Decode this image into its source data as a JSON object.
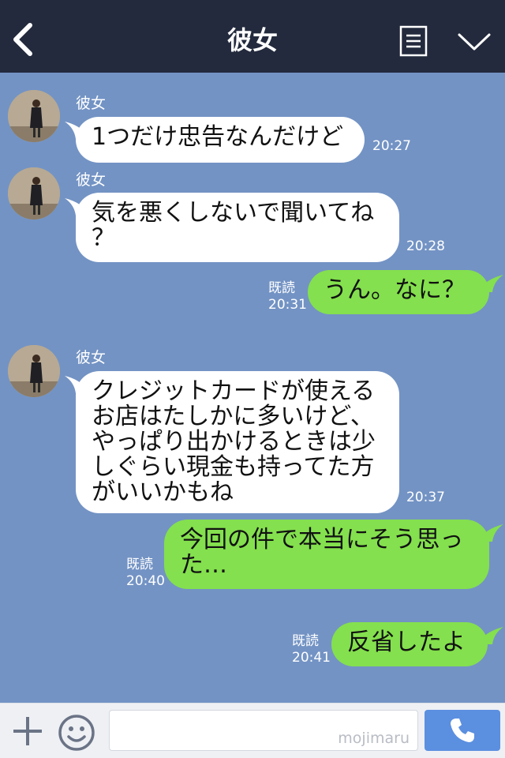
{
  "header": {
    "title": "彼女"
  },
  "messages": [
    {
      "sender": "彼女",
      "text": "1つだけ忠告なんだけど",
      "time": "20:27"
    },
    {
      "sender": "彼女",
      "lines": [
        "気を悪くしないで聞いてね",
        "？"
      ],
      "time": "20:28"
    },
    {
      "text": "うん。なに？",
      "read": "既読",
      "time": "20:31"
    },
    {
      "sender": "彼女",
      "lines": [
        "クレジットカードが使える",
        "お店はたしかに多いけど、",
        "やっぱり出かけるときは少",
        "しぐらい現金も持ってた方",
        "がいいかもね"
      ],
      "time": "20:37"
    },
    {
      "lines": [
        "今回の件で本当にそう思っ",
        "た…"
      ],
      "read": "既読",
      "time": "20:40"
    },
    {
      "text": "反省したよ",
      "read": "既読",
      "time": "20:41"
    }
  ],
  "composer": {
    "watermark": "mojimaru"
  },
  "icons": {
    "back": "chevron-left-icon",
    "menu": "list-menu-icon",
    "collapse": "chevron-down-icon",
    "plus": "plus-icon",
    "sticker": "smiley-icon",
    "send": "phone-icon"
  },
  "colors": {
    "header_bg": "#232a3d",
    "chat_bg": "#7393c4",
    "incoming_bubble": "#ffffff",
    "outgoing_bubble": "#84e04e",
    "send_button": "#5b8fe0"
  }
}
